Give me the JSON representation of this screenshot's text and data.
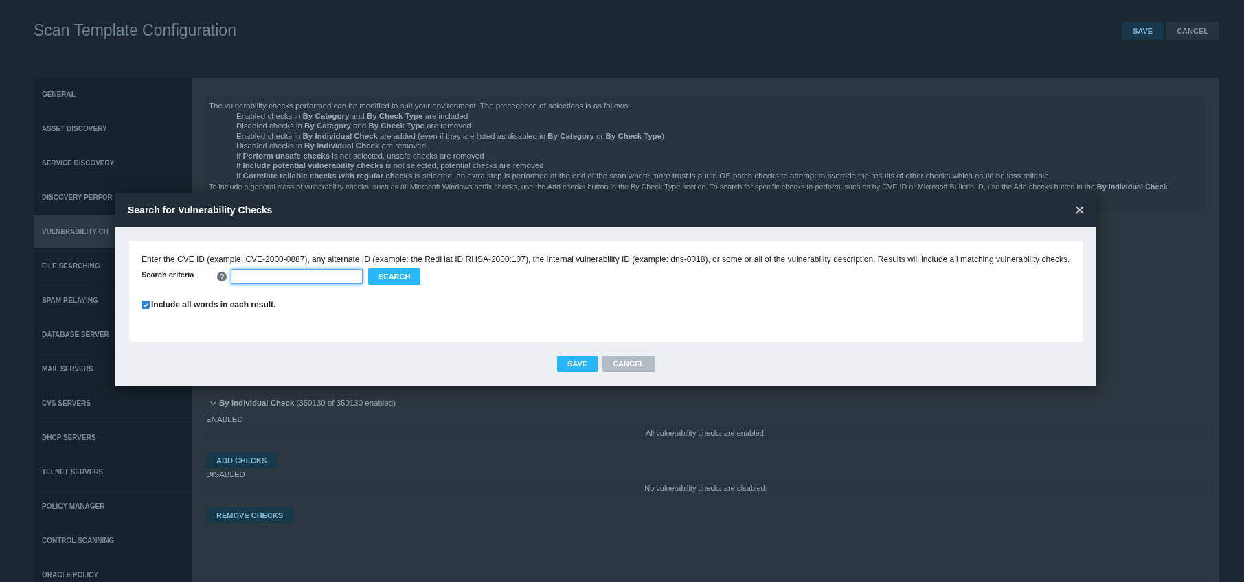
{
  "page": {
    "title": "Scan Template Configuration",
    "buttons": [
      {
        "label": "SAVE",
        "kind": "primary"
      },
      {
        "label": "CANCEL",
        "kind": "secondary"
      }
    ]
  },
  "sidebar": {
    "items": [
      {
        "label": "GENERAL",
        "selected": false
      },
      {
        "label": "ASSET DISCOVERY",
        "selected": false
      },
      {
        "label": "SERVICE DISCOVERY",
        "selected": false
      },
      {
        "label": "DISCOVERY PERFOR",
        "selected": false
      },
      {
        "label": "VULNERABILITY CH",
        "selected": true
      },
      {
        "label": "FILE SEARCHING",
        "selected": false
      },
      {
        "label": "SPAM RELAYING",
        "selected": false
      },
      {
        "label": "DATABASE SERVER",
        "selected": false
      },
      {
        "label": "MAIL SERVERS",
        "selected": false
      },
      {
        "label": "CVS SERVERS",
        "selected": false
      },
      {
        "label": "DHCP SERVERS",
        "selected": false
      },
      {
        "label": "TELNET SERVERS",
        "selected": false
      },
      {
        "label": "POLICY MANAGER",
        "selected": false
      },
      {
        "label": "CONTROL SCANNING",
        "selected": false
      },
      {
        "label": "ORACLE POLICY",
        "selected": false
      }
    ]
  },
  "info": {
    "intro": "The vulnerability checks performed can be modified to suit your environment. The precedence of selections is as follows:",
    "rules": [
      "Enabled checks in **By Category** and **By Check Type** are included",
      "Disabled checks in **By Category** and **By Check Type** are removed",
      "Enabled checks in **By Individual Check** are added (even if they are listed as disabled in **By Category** or **By Check Type**)",
      "Disabled checks in **By Individual Check** are removed",
      "If **Perform unsafe checks** is not selected, unsafe checks are removed",
      "If **Include potential vulnerability checks** is not selected, potential checks are removed",
      "If **Correlate reliable checks with regular checks** is selected, an extra step is performed at the end of the scan where more trust is put in OS patch checks to attempt to override the results of other checks which could be less reliable"
    ],
    "note": "To include a general class of vulnerability checks, such as all Microsoft Windows hotfix checks, use the Add checks button in the By Check Type section. To search for specific checks to perform, such as by CVE ID or Microsoft Bulletin ID, use the Add checks button in the **By Individual Check**"
  },
  "individual_check": {
    "heading": "By Individual Check",
    "count": "(350130 of 350130 enabled)",
    "expanded": true,
    "enabled_label": "ENABLED",
    "enabled_message": "All vulnerability checks are enabled.",
    "add_button": "ADD CHECKS",
    "disabled_label": "DISABLED",
    "disabled_message": "No vulnerability checks are disabled.",
    "remove_button": "REMOVE CHECKS"
  },
  "dialog": {
    "title": "Search for Vulnerability Checks",
    "description": "Enter the CVE ID (example: CVE-2000-0887), any alternate ID (example: the RedHat ID RHSA-2000:107), the internal vulnerability ID (example: dns-0018), or some or all of the vulnerability description. Results will include all matching vulnerability checks.",
    "field_label": "Search criteria",
    "help_icon": "?",
    "search_focused": true,
    "search_button": "SEARCH",
    "checkbox": {
      "label": "Include all words in each result.",
      "checked": true
    },
    "buttons": [
      {
        "label": "SAVE",
        "kind": "primary"
      },
      {
        "label": "CANCEL",
        "kind": "secondary"
      }
    ]
  }
}
